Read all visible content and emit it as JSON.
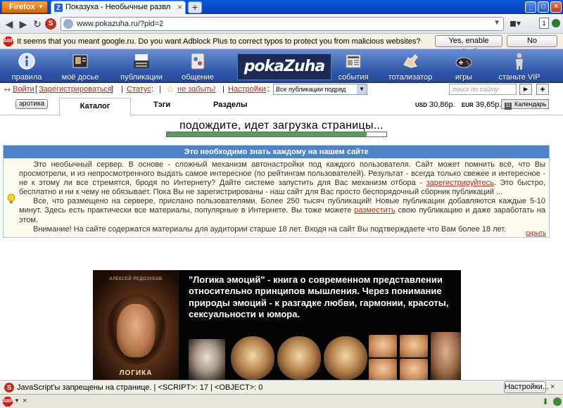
{
  "browser": {
    "menu_label": "Firefox",
    "tab_title": "Показуха - Необычные развлечения: Афо",
    "favicon_letter": "Z",
    "close_glyph": "×",
    "new_tab_glyph": "+",
    "url": "www.pokazuha.ru/?pid=2",
    "badge_count": "1"
  },
  "notification": {
    "icon_label": "ABP",
    "text": "It seems that you meant google.ru. Do you want Adblock Plus to correct typos to protect you from malicious websites?",
    "yes_button": "Yes, enable protection",
    "no_button": "No"
  },
  "site_header": {
    "logo_text": "pokaZuha",
    "nav": [
      {
        "label": "правила",
        "icon": "info-icon"
      },
      {
        "label": "моё досье",
        "icon": "dossier-icon"
      },
      {
        "label": "публикации",
        "icon": "typewriter-icon"
      },
      {
        "label": "общение",
        "icon": "chat-icon"
      },
      {
        "label": "события",
        "icon": "newspaper-icon"
      },
      {
        "label": "тотализатор",
        "icon": "hand-icon"
      },
      {
        "label": "игры",
        "icon": "gamepad-icon"
      },
      {
        "label": "станьте VIP",
        "icon": "vip-figure-icon"
      }
    ]
  },
  "login_row": {
    "login": "Войти",
    "register": "Зарегистрироваться",
    "status": "Статус",
    "dont_forget": "не забыть!",
    "settings": "Настройки",
    "filter_value": "Все публикации подряд",
    "search_placeholder": "поиск по сайту"
  },
  "tabs": {
    "erotika": "эротика",
    "catalog": "Каталог",
    "tags": "Тэги",
    "sections": "Разделы"
  },
  "currency": {
    "usd_code": "USD",
    "usd_rate": "30,86р.",
    "eur_code": "EUR",
    "eur_rate": "39,65р.",
    "calendar_day": "11",
    "calendar_label": "Календарь"
  },
  "loading": {
    "text": "подождите, идет загрузка страницы...",
    "progress": 0.91
  },
  "info_box": {
    "header": "Это необходимо знать каждому на нашем сайте",
    "p1_before": "Это необычный сервер. В основе - сложный механизм автонастройки под каждого пользователя. Сайт может помнить всё, что Вы просмотрели, и из непросмотренного выдать самое интересное (по рейтингам пользователей). Результат - всегда только свежее и интересное - не к этому ли все стремятся, бродя по Интернету? Дайте системе запустить для Вас механизм отбора - ",
    "p1_link": "зарегистрируйтесь",
    "p1_after": ". Это быстро, бесплатно и ни к чему не обязывает. Пока Вы не зарегистрированы - наш сайт для Вас просто беспорядочный сборник публикаций ...",
    "p2_before": "Все, что размещено на сервере, прислано пользователями. Более 250 тысяч публикаций! Новые публикации добавляются каждые 5-10 минут. Здесь есть практически все материалы, популярные в Интернете. Вы тоже можете ",
    "p2_link": "разместить",
    "p2_after": " свою публикацию и даже заработать на этом.",
    "p3": "Внимание! На сайте содержатся материалы для аудитории старше 18 лет. Входя на сайт Вы подтверждаете что Вам более 18 лет.",
    "hide": "скрыть"
  },
  "banner": {
    "book_author": "АЛЕКСЕЙ РЕДОЗУБОВ",
    "book_title": "ЛОГИКА",
    "text": "\"Логика эмоций\" - книга о современном представлении относительно принципов мышления. Через понимание природы эмоций - к разгадке любви, гармонии, красоты, сексуальности и юмора."
  },
  "noscript": {
    "icon_letter": "S",
    "text": "JavaScript'ы запрещены на странице. | <SCRIPT>: 17 | <OBJECT>: 0",
    "settings": "Настройки..."
  },
  "statusbar": {
    "abp_label": "ABP"
  },
  "colors": {
    "header_blue": "#2f55a8",
    "info_header": "#4f83c6",
    "link_red": "#b03018",
    "progress_green": "#5a9a5a"
  }
}
